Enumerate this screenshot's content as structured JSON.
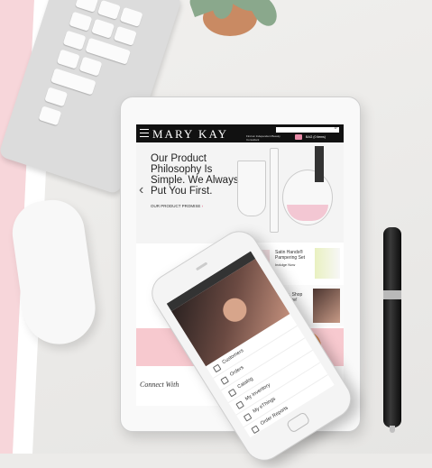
{
  "tablet_screen": {
    "brand": "MARY KAY",
    "consultant_text": "Find an Independent Beauty Consultant",
    "bag_text": "BAG (0 items)",
    "hero_title": "Our Product Philosophy Is Simple. We Always Put You First.",
    "hero_link": "OUR PRODUCT PROMISE",
    "promo1": "Satin Hands® Pampering Set",
    "promo1_link": "Indulge Now",
    "promo2": "Search, Shop and Share!",
    "promo2_link": "eCatalog",
    "connect": "Connect With"
  },
  "phone_screen": {
    "menu": [
      "Customers",
      "Orders",
      "Catalog",
      "My Inventory",
      "My eThings",
      "Order Reports"
    ]
  },
  "colors": {
    "accent_pink": "#e03a68",
    "band_pink": "#f7d6da",
    "header_black": "#111111"
  }
}
